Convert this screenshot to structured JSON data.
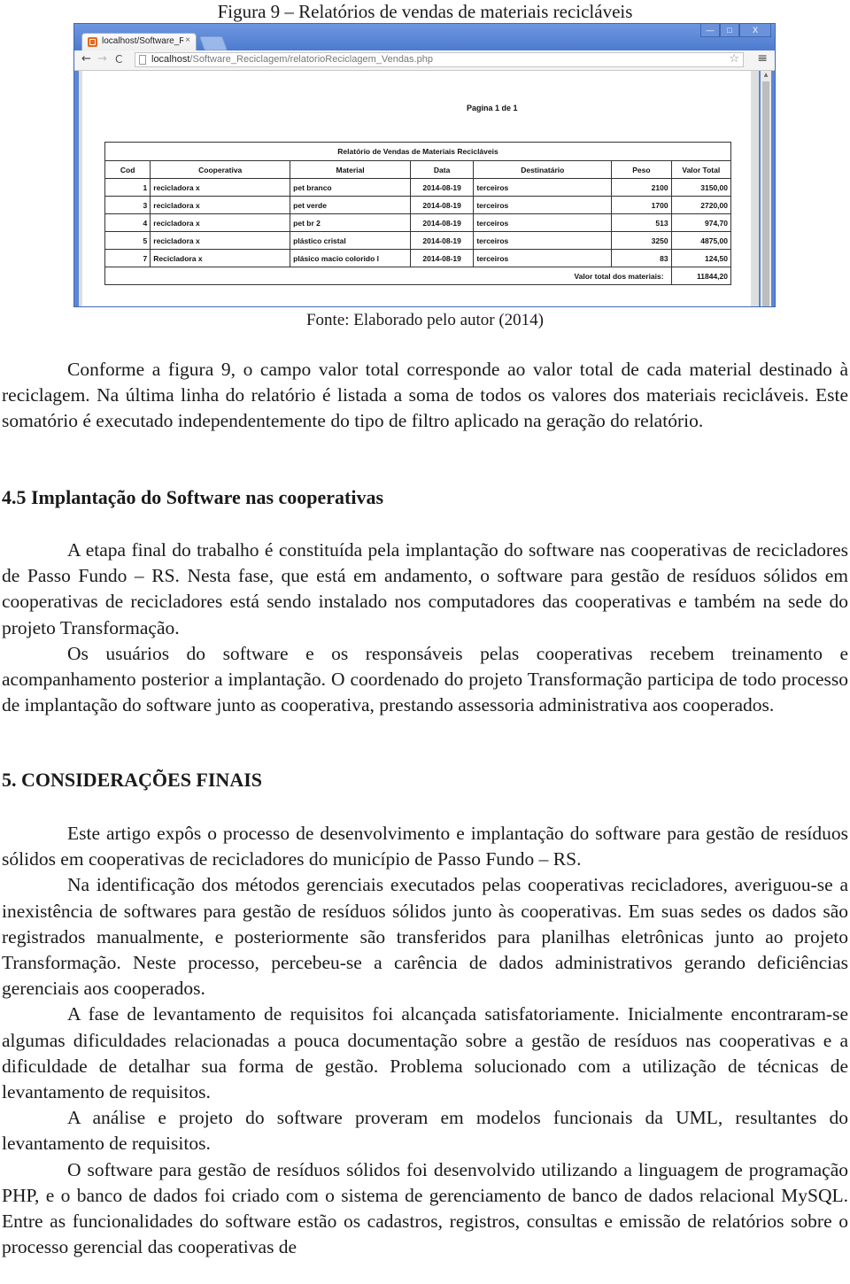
{
  "figure": {
    "title": "Figura 9 – Relatórios de vendas de materiais recicláveis",
    "caption": "Fonte: Elaborado pelo autor (2014)"
  },
  "browser": {
    "tab_title": "localhost/Software_Recicl",
    "tab_close": "×",
    "url_host": "localhost",
    "url_path": "/Software_Reciclagem/relatorioReciclagem_Vendas.php",
    "icons": {
      "back": "←",
      "forward": "→",
      "reload": "C",
      "star": "☆",
      "menu": "≡",
      "minimize": "—",
      "maximize": "□",
      "close": "X",
      "scroll_up": "▲"
    }
  },
  "report": {
    "page_info": "Pagina 1 de 1",
    "title": "Relatório de Vendas de Materiais Recicláveis",
    "columns": [
      "Cod",
      "Cooperativa",
      "Material",
      "Data",
      "Destinatário",
      "Peso",
      "Valor Total"
    ],
    "rows": [
      {
        "cod": "1",
        "cooperativa": "recicladora x",
        "material": "pet branco",
        "data": "2014-08-19",
        "destinatario": "terceiros",
        "peso": "2100",
        "valor": "3150,00"
      },
      {
        "cod": "3",
        "cooperativa": "recicladora x",
        "material": "pet verde",
        "data": "2014-08-19",
        "destinatario": "terceiros",
        "peso": "1700",
        "valor": "2720,00"
      },
      {
        "cod": "4",
        "cooperativa": "recicladora x",
        "material": "pet br 2",
        "data": "2014-08-19",
        "destinatario": "terceiros",
        "peso": "513",
        "valor": "974,70"
      },
      {
        "cod": "5",
        "cooperativa": "recicladora x",
        "material": "plástico cristal",
        "data": "2014-08-19",
        "destinatario": "terceiros",
        "peso": "3250",
        "valor": "4875,00"
      },
      {
        "cod": "7",
        "cooperativa": "Recicladora x",
        "material": "plásico macio colorido l",
        "data": "2014-08-19",
        "destinatario": "terceiros",
        "peso": "83",
        "valor": "124,50"
      }
    ],
    "total_label": "Valor total dos materiais:",
    "total_value": "11844,20"
  },
  "text": {
    "para_intro": "Conforme a figura 9, o campo valor total corresponde ao valor total de cada material destinado à reciclagem. Na última linha do relatório é listada a soma de todos os valores dos materiais recicláveis. Este somatório é executado independentemente do tipo de filtro aplicado na geração do relatório.",
    "heading_45": "4.5 Implantação do Software nas cooperativas",
    "para_45_1": "A etapa final do trabalho é constituída pela implantação do software nas cooperativas de recicladores de Passo Fundo – RS. Nesta fase, que está em andamento, o software para gestão de resíduos sólidos em cooperativas de recicladores está sendo instalado nos computadores das cooperativas e também na sede do projeto Transformação.",
    "para_45_2": "Os usuários do software e os responsáveis pelas cooperativas recebem treinamento e acompanhamento posterior a implantação. O coordenado do projeto Transformação participa de todo processo de implantação do software junto as cooperativa, prestando assessoria administrativa aos cooperados.",
    "heading_5": "5. CONSIDERAÇÕES FINAIS",
    "para_5_1": "Este artigo expôs o processo de desenvolvimento e implantação do software para gestão de resíduos sólidos em cooperativas de recicladores do município de Passo Fundo – RS.",
    "para_5_2": "Na identificação dos métodos gerenciais executados pelas cooperativas recicladores, averiguou-se a inexistência de softwares para gestão de resíduos sólidos junto às cooperativas. Em suas sedes os dados são registrados manualmente, e posteriormente são transferidos para planilhas eletrônicas junto ao projeto Transformação. Neste processo, percebeu-se a carência de dados administrativos gerando deficiências gerenciais aos cooperados.",
    "para_5_3": "A fase de levantamento de requisitos foi alcançada satisfatoriamente. Inicialmente encontraram-se algumas dificuldades relacionadas a pouca documentação sobre a gestão de resíduos nas cooperativas e a dificuldade de detalhar sua forma de gestão. Problema solucionado com a utilização de técnicas de levantamento de requisitos.",
    "para_5_4": "A análise e projeto do software proveram em modelos funcionais da UML, resultantes do levantamento de requisitos.",
    "para_5_5": "O software para gestão de resíduos sólidos foi desenvolvido utilizando a linguagem de programação PHP, e o banco de dados foi criado com o sistema de gerenciamento de banco de dados relacional MySQL. Entre as funcionalidades do software estão os cadastros, registros, consultas e emissão de relatórios sobre o processo gerencial das cooperativas de"
  }
}
